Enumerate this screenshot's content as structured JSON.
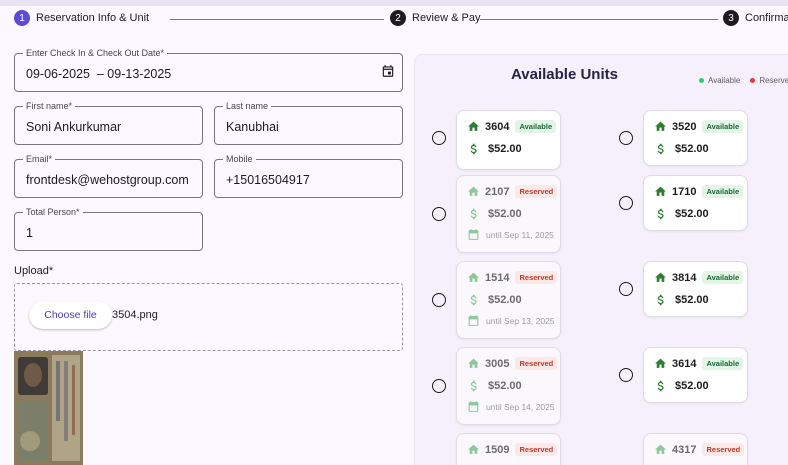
{
  "stepper": {
    "steps": [
      {
        "number": "1",
        "label": "Reservation Info & Unit"
      },
      {
        "number": "2",
        "label": "Review & Pay"
      },
      {
        "number": "3",
        "label": "Confirmat"
      }
    ]
  },
  "form": {
    "dates": {
      "label": "Enter Check In & Check Out Date*",
      "value": "09-06-2025  – 09-13-2025"
    },
    "first_name": {
      "label": "First name*",
      "value": "Soni Ankurkumar"
    },
    "last_name": {
      "label": "Last name",
      "value": "Kanubhai"
    },
    "email": {
      "label": "Email*",
      "value": "frontdesk@wehostgroup.com"
    },
    "mobile": {
      "label": "Mobile",
      "value": "+15016504917"
    },
    "total_person": {
      "label": "Total Person*",
      "value": "1"
    },
    "upload": {
      "label": "Upload*",
      "button": "Choose file",
      "file_name": "3504.png"
    }
  },
  "units": {
    "title": "Available Units",
    "legend": {
      "available": "Available",
      "reserved": "Reserved"
    },
    "colors": {
      "available": "#2e7d32",
      "reserved": "#e53935",
      "available_icon": "#2e7d32",
      "reserved_icon": "#8fc79a"
    },
    "items": [
      {
        "number": "3604",
        "status": "Available",
        "price": "$52.00",
        "until": ""
      },
      {
        "number": "3520",
        "status": "Available",
        "price": "$52.00",
        "until": ""
      },
      {
        "number": "2107",
        "status": "Reserved",
        "price": "$52.00",
        "until": "until Sep 11, 2025"
      },
      {
        "number": "1710",
        "status": "Available",
        "price": "$52.00",
        "until": ""
      },
      {
        "number": "1514",
        "status": "Reserved",
        "price": "$52.00",
        "until": "until Sep 13, 2025"
      },
      {
        "number": "3814",
        "status": "Available",
        "price": "$52.00",
        "until": ""
      },
      {
        "number": "3005",
        "status": "Reserved",
        "price": "$52.00",
        "until": "until Sep 14, 2025"
      },
      {
        "number": "3614",
        "status": "Available",
        "price": "$52.00",
        "until": ""
      },
      {
        "number": "1509",
        "status": "Reserved",
        "price": "",
        "until": ""
      },
      {
        "number": "4317",
        "status": "Reserved",
        "price": "",
        "until": ""
      }
    ]
  }
}
